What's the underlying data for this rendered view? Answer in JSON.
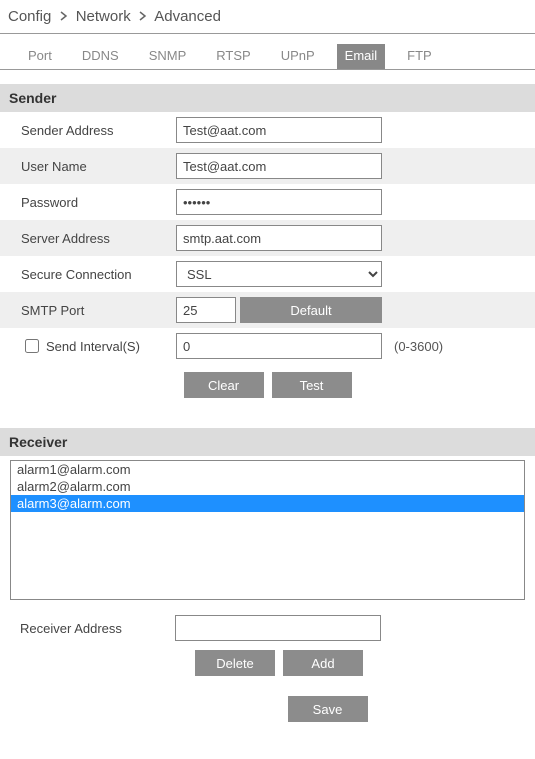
{
  "breadcrumb": {
    "items": [
      "Config",
      "Network",
      "Advanced"
    ]
  },
  "tabs": {
    "items": [
      {
        "label": "Port",
        "active": false
      },
      {
        "label": "DDNS",
        "active": false
      },
      {
        "label": "SNMP",
        "active": false
      },
      {
        "label": "RTSP",
        "active": false
      },
      {
        "label": "UPnP",
        "active": false
      },
      {
        "label": "Email",
        "active": true
      },
      {
        "label": "FTP",
        "active": false
      }
    ]
  },
  "sender": {
    "header": "Sender",
    "labels": {
      "sender_address": "Sender Address",
      "user_name": "User Name",
      "password": "Password",
      "server_address": "Server Address",
      "secure_connection": "Secure Connection",
      "smtp_port": "SMTP Port",
      "send_interval": "Send Interval(S)"
    },
    "values": {
      "sender_address": "Test@aat.com",
      "user_name": "Test@aat.com",
      "password": "••••••",
      "server_address": "smtp.aat.com",
      "secure_connection": "SSL",
      "smtp_port": "25",
      "send_interval": "0",
      "send_interval_checked": false
    },
    "send_interval_hint": "(0-3600)",
    "buttons": {
      "default": "Default",
      "clear": "Clear",
      "test": "Test"
    }
  },
  "receiver": {
    "header": "Receiver",
    "list": [
      {
        "text": "alarm1@alarm.com",
        "selected": false
      },
      {
        "text": "alarm2@alarm.com",
        "selected": false
      },
      {
        "text": "alarm3@alarm.com",
        "selected": true
      }
    ],
    "label_receiver_address": "Receiver Address",
    "receiver_address_value": "",
    "buttons": {
      "delete": "Delete",
      "add": "Add"
    }
  },
  "save_label": "Save"
}
